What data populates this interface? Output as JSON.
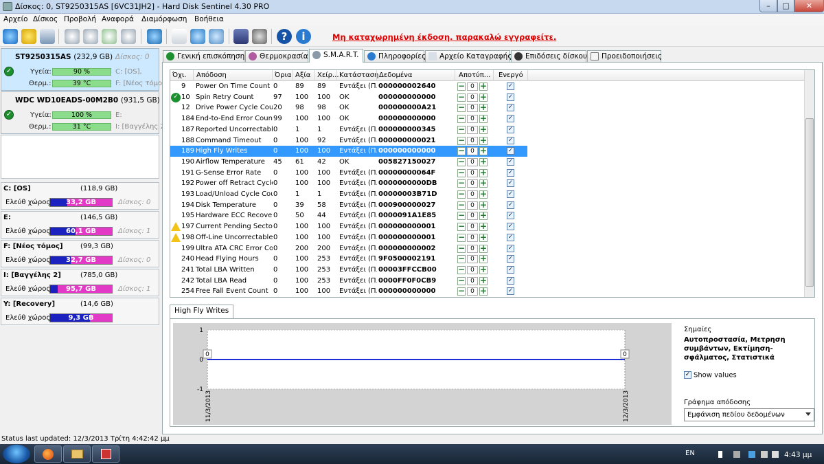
{
  "window": {
    "title": "Δίσκος: 0, ST9250315AS [6VC31JH2]  -  Hard Disk Sentinel 4.30 PRO",
    "min": "–",
    "max": "□",
    "close": "✕"
  },
  "menu": [
    "Αρχείο",
    "Δίσκος",
    "Προβολή",
    "Αναφορά",
    "Διαμόρφωση",
    "Βοήθεια"
  ],
  "toolbar": {
    "warning": "Μη καταχωρημένη έκδοση. παρακαλώ εγγραφείτε."
  },
  "disks": [
    {
      "name": "ST9250315AS",
      "size": "(232,9 GB)",
      "index": "Δίσκος: 0",
      "health_label": "Υγεία:",
      "health": "90 %",
      "health_pct": 90,
      "temp_label": "Θερμ.:",
      "temp": "39 °C",
      "temp_pct": 39,
      "part1": "C: [OS],",
      "part2": "F: [Νέος τόμο"
    },
    {
      "name": "WDC WD10EADS-00M2B0",
      "size": "(931,5 GB)",
      "index": "",
      "health_label": "Υγεία:",
      "health": "100 %",
      "health_pct": 100,
      "temp_label": "Θερμ.:",
      "temp": "31 °C",
      "temp_pct": 31,
      "part1": "E:",
      "part2": "I: [Βαγγέλης 2"
    }
  ],
  "volumes": [
    {
      "name": "C: [OS]",
      "capacity": "(118,9 GB)",
      "free_label": "Ελεύθ χώρος",
      "free": "33,2 GB",
      "free_pct": 28,
      "disk": "Δίσκος: 0"
    },
    {
      "name": "E:",
      "capacity": "(146,5 GB)",
      "free_label": "Ελεύθ χώρος",
      "free": "60,1 GB",
      "free_pct": 41,
      "disk": "Δίσκος: 1"
    },
    {
      "name": "F: [Νέος τόμος]",
      "capacity": "(99,3 GB)",
      "free_label": "Ελεύθ χώρος",
      "free": "32,7 GB",
      "free_pct": 33,
      "disk": "Δίσκος: 0"
    },
    {
      "name": "I: [Βαγγέλης 2]",
      "capacity": "(785,0 GB)",
      "free_label": "Ελεύθ χώρος",
      "free": "95,7 GB",
      "free_pct": 12,
      "disk": "Δίσκος: 1"
    },
    {
      "name": "Y: [Recovery]",
      "capacity": "(14,6 GB)",
      "free_label": "Ελεύθ χώρος",
      "free": "9,3 GB",
      "free_pct": 64,
      "disk": ""
    }
  ],
  "tabs": [
    "Γενική επισκόπηση",
    "Θερμοκρασία",
    "S.M.A.R.T.",
    "Πληροφορίες",
    "Αρχείο Καταγραφής",
    "Επιδόσεις δίσκου",
    "Προειδοποιήσεις"
  ],
  "smart": {
    "headers": [
      "Όχι.",
      "Απόδοση",
      "Όρια",
      "Αξία",
      "Χείρ...",
      "Κατάσταση",
      "Δεδομένα",
      "Αποτύπ...",
      "Ενεργό"
    ],
    "rows": [
      {
        "id": "9",
        "name": "Power On Time Count",
        "thr": "0",
        "val": "89",
        "worst": "89",
        "status": "Εντάξει (Π...",
        "data": "000000002640",
        "icon": "",
        "sel": false
      },
      {
        "id": "10",
        "name": "Spin Retry Count",
        "thr": "97",
        "val": "100",
        "worst": "100",
        "status": "OK",
        "data": "000000000000",
        "icon": "ok",
        "sel": false
      },
      {
        "id": "12",
        "name": "Drive Power Cycle Count",
        "thr": "20",
        "val": "98",
        "worst": "98",
        "status": "OK",
        "data": "000000000A21",
        "icon": "",
        "sel": false
      },
      {
        "id": "184",
        "name": "End-to-End Error Count",
        "thr": "99",
        "val": "100",
        "worst": "100",
        "status": "OK",
        "data": "000000000000",
        "icon": "",
        "sel": false
      },
      {
        "id": "187",
        "name": "Reported Uncorrectabl...",
        "thr": "0",
        "val": "1",
        "worst": "1",
        "status": "Εντάξει (Π...",
        "data": "000000000345",
        "icon": "",
        "sel": false
      },
      {
        "id": "188",
        "name": "Command Timeout",
        "thr": "0",
        "val": "100",
        "worst": "92",
        "status": "Εντάξει (Π...",
        "data": "000000000021",
        "icon": "",
        "sel": false
      },
      {
        "id": "189",
        "name": "High Fly Writes",
        "thr": "0",
        "val": "100",
        "worst": "100",
        "status": "Εντάξει (Π...",
        "data": "000000000000",
        "icon": "",
        "sel": true
      },
      {
        "id": "190",
        "name": "Airflow Temperature",
        "thr": "45",
        "val": "61",
        "worst": "42",
        "status": "OK",
        "data": "005827150027",
        "icon": "",
        "sel": false
      },
      {
        "id": "191",
        "name": "G-Sense Error Rate",
        "thr": "0",
        "val": "100",
        "worst": "100",
        "status": "Εντάξει (Π...",
        "data": "00000000064F",
        "icon": "",
        "sel": false
      },
      {
        "id": "192",
        "name": "Power off Retract Cycle ...",
        "thr": "0",
        "val": "100",
        "worst": "100",
        "status": "Εντάξει (Π...",
        "data": "0000000000DB",
        "icon": "",
        "sel": false
      },
      {
        "id": "193",
        "name": "Load/Unload Cycle Cou...",
        "thr": "0",
        "val": "1",
        "worst": "1",
        "status": "Εντάξει (Π...",
        "data": "00000003B71D",
        "icon": "",
        "sel": false
      },
      {
        "id": "194",
        "name": "Disk Temperature",
        "thr": "0",
        "val": "39",
        "worst": "58",
        "status": "Εντάξει (Π...",
        "data": "000900000027",
        "icon": "",
        "sel": false
      },
      {
        "id": "195",
        "name": "Hardware ECC Recovered",
        "thr": "0",
        "val": "50",
        "worst": "44",
        "status": "Εντάξει (Π...",
        "data": "0000091A1E85",
        "icon": "",
        "sel": false
      },
      {
        "id": "197",
        "name": "Current Pending Sector...",
        "thr": "0",
        "val": "100",
        "worst": "100",
        "status": "Εντάξει (Π...",
        "data": "000000000001",
        "icon": "warn",
        "sel": false
      },
      {
        "id": "198",
        "name": "Off-Line Uncorrectable ...",
        "thr": "0",
        "val": "100",
        "worst": "100",
        "status": "Εντάξει (Π...",
        "data": "000000000001",
        "icon": "warn",
        "sel": false
      },
      {
        "id": "199",
        "name": "Ultra ATA CRC Error Co...",
        "thr": "0",
        "val": "200",
        "worst": "200",
        "status": "Εντάξει (Π...",
        "data": "000000000002",
        "icon": "",
        "sel": false
      },
      {
        "id": "240",
        "name": "Head Flying Hours",
        "thr": "0",
        "val": "100",
        "worst": "253",
        "status": "Εντάξει (Π...",
        "data": "9F0500002191",
        "icon": "",
        "sel": false
      },
      {
        "id": "241",
        "name": "Total LBA Written",
        "thr": "0",
        "val": "100",
        "worst": "253",
        "status": "Εντάξει (Π...",
        "data": "00003FFCCB00",
        "icon": "",
        "sel": false
      },
      {
        "id": "242",
        "name": "Total LBA Read",
        "thr": "0",
        "val": "100",
        "worst": "253",
        "status": "Εντάξει (Π...",
        "data": "0000FF0F0CB9",
        "icon": "",
        "sel": false
      },
      {
        "id": "254",
        "name": "Free Fall Event Count",
        "thr": "0",
        "val": "100",
        "worst": "100",
        "status": "Εντάξει (Π...",
        "data": "000000000000",
        "icon": "",
        "sel": false
      }
    ],
    "offset_value": "0",
    "check": "✓"
  },
  "chart_panel": {
    "tab": "High Fly Writes",
    "flags_title": "Σημαίες",
    "flags_text": "Αυτοπροστασία, Μετρηση συμβάντων, Εκτίμηση-σφάλματος, Στατιστικά",
    "show_values_label": "Show values",
    "perf_label": "Γράφημα απόδοσης",
    "perf_option": "Εμφάνιση πεδίου δεδομένων"
  },
  "chart_data": {
    "type": "line",
    "x": [
      "11/3/2013",
      "12/3/2013"
    ],
    "series": [
      {
        "values": [
          0,
          0
        ]
      }
    ],
    "y_ticks": [
      "1",
      "0",
      "-1"
    ],
    "ylim": [
      -1,
      1
    ],
    "point_labels": [
      "0",
      "0"
    ],
    "line_color": "#1c2fd6"
  },
  "status": "Status last updated: 12/3/2013 Τρίτη 4:42:42 μμ",
  "taskbar": {
    "lang": "EN",
    "time": "4:43 μμ"
  }
}
